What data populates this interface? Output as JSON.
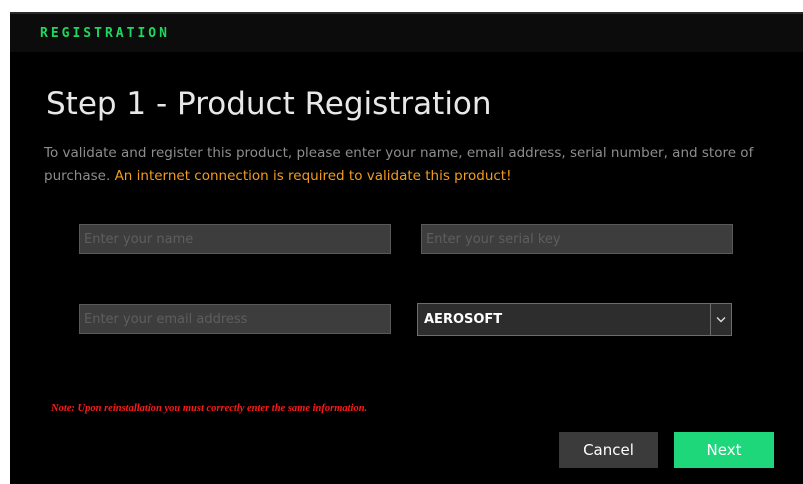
{
  "header": {
    "title": "REGISTRATION"
  },
  "page": {
    "step_title": "Step 1 - Product Registration",
    "intro_text": "To validate and register this product, please enter your name, email address, serial number, and store of purchase. ",
    "intro_warning": "An internet connection is required to validate this product!"
  },
  "form": {
    "name_placeholder": "Enter your name",
    "serial_placeholder": "Enter your serial key",
    "email_placeholder": "Enter your email address",
    "store_selected": "AEROSOFT",
    "store_icon": "chevron-down-icon"
  },
  "note": "Note: Upon reinstallation you must correctly enter the same information.",
  "buttons": {
    "cancel_label": "Cancel",
    "next_label": "Next"
  },
  "colors": {
    "accent": "#1ed760",
    "next_button": "#1ed77a",
    "warning": "#f39c1f",
    "note": "#ff1a1a",
    "background": "#000000"
  }
}
